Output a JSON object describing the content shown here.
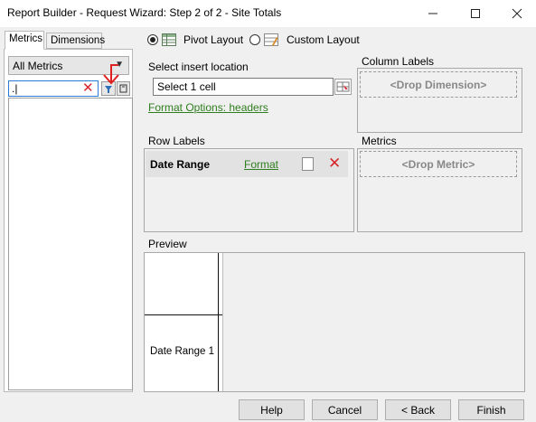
{
  "window": {
    "title": "Report Builder - Request Wizard: Step 2 of 2 - Site Totals",
    "minimize": "—",
    "maximize": "☐",
    "close": "✕"
  },
  "left": {
    "tabs": [
      {
        "label": "Metrics",
        "active": true
      },
      {
        "label": "Dimensions",
        "active": false
      }
    ],
    "category_select": "All Metrics",
    "search_value": ".|",
    "search_clear": "✕"
  },
  "layout": {
    "pivot_label": "Pivot Layout",
    "custom_label": "Custom Layout",
    "selected": "pivot"
  },
  "insert": {
    "label": "Select insert location",
    "value": "Select 1 cell",
    "format_link": "Format Options: headers"
  },
  "column_labels": {
    "heading": "Column Labels",
    "placeholder": "<Drop Dimension>"
  },
  "row_labels": {
    "heading": "Row Labels",
    "items": [
      {
        "name": "Date Range",
        "format": "Format",
        "delete": "✕"
      }
    ]
  },
  "metrics": {
    "heading": "Metrics",
    "placeholder": "<Drop Metric>"
  },
  "preview": {
    "heading": "Preview",
    "cell_text": "Date Range 1"
  },
  "buttons": {
    "help": "Help",
    "cancel": "Cancel",
    "back": "< Back",
    "finish": "Finish"
  },
  "colors": {
    "link_green": "#2e7d1e",
    "delete_red": "#d8262b",
    "annotation_red": "#e02020",
    "focus_blue": "#2b7ad7"
  }
}
